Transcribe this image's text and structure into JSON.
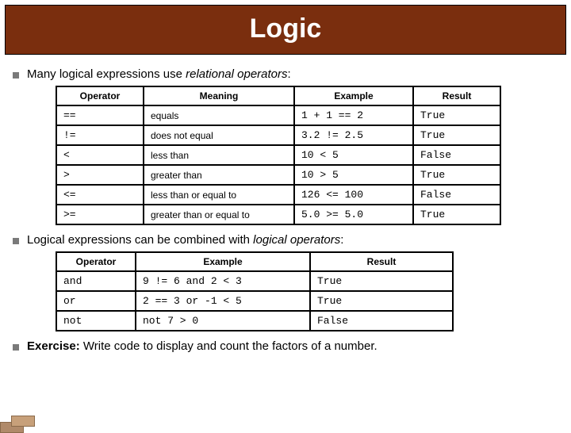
{
  "title": "Logic",
  "bullet1_a": "Many logical expressions use ",
  "bullet1_b": "relational operators",
  "bullet1_c": ":",
  "table1": {
    "headers": {
      "c1": "Operator",
      "c2": "Meaning",
      "c3": "Example",
      "c4": "Result"
    },
    "rows": [
      {
        "op": "==",
        "meaning": "equals",
        "example": "1 + 1 == 2",
        "result": "True"
      },
      {
        "op": "!=",
        "meaning": "does not equal",
        "example": "3.2 != 2.5",
        "result": "True"
      },
      {
        "op": "<",
        "meaning": "less than",
        "example": "10 < 5",
        "result": "False"
      },
      {
        "op": ">",
        "meaning": "greater than",
        "example": "10 > 5",
        "result": "True"
      },
      {
        "op": "<=",
        "meaning": "less than or equal to",
        "example": "126 <= 100",
        "result": "False"
      },
      {
        "op": ">=",
        "meaning": "greater than or equal to",
        "example": "5.0 >= 5.0",
        "result": "True"
      }
    ]
  },
  "bullet2_a": "Logical expressions can be combined with ",
  "bullet2_b": "logical operators",
  "bullet2_c": ":",
  "table2": {
    "headers": {
      "c1": "Operator",
      "c2": "Example",
      "c3": "Result"
    },
    "rows": [
      {
        "op": "and",
        "example": "9 != 6 and 2 < 3",
        "result": "True"
      },
      {
        "op": "or",
        "example": "2 == 3 or -1 < 5",
        "result": "True"
      },
      {
        "op": "not",
        "example": "not 7 > 0",
        "result": "False"
      }
    ]
  },
  "bullet3_a": "Exercise:",
  "bullet3_b": " Write code to display and count the factors of a number."
}
